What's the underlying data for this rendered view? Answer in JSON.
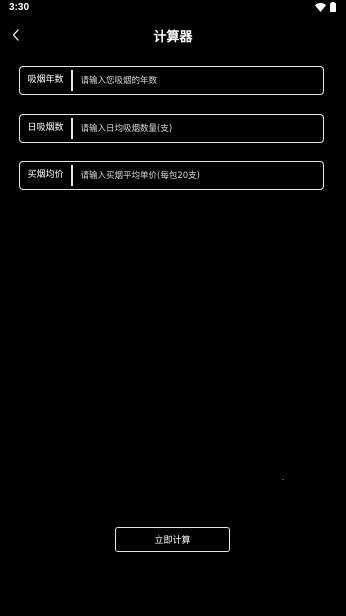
{
  "status_bar": {
    "time": "3:30",
    "icons": [
      "wifi-icon",
      "battery-icon"
    ]
  },
  "header": {
    "back_icon": "chevron-left-icon",
    "title": "计算器"
  },
  "form": {
    "fields": [
      {
        "label": "吸烟年数",
        "placeholder": "请输入您吸烟的年数",
        "value": ""
      },
      {
        "label": "日吸烟数",
        "placeholder": "请输入日均吸烟数量(支)",
        "value": ""
      },
      {
        "label": "买烟均价",
        "placeholder": "请输入买烟平均单价(每包20支)",
        "value": ""
      }
    ]
  },
  "actions": {
    "calculate_label": "立即计算"
  },
  "colors": {
    "background": "#000000",
    "border": "#e6e6e6",
    "text": "#ffffff"
  }
}
